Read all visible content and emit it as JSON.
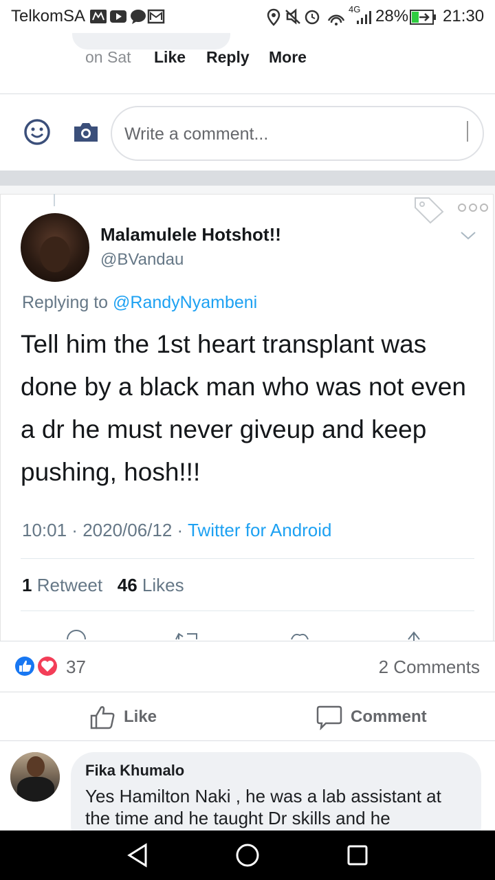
{
  "status_bar": {
    "carrier": "TelkomSA",
    "network": "4G",
    "battery": "28%",
    "time": "21:30"
  },
  "previous_comment": {
    "time": "on Sat",
    "like_label": "Like",
    "reply_label": "Reply",
    "more_label": "More"
  },
  "composer": {
    "placeholder": "Write a comment..."
  },
  "tweet": {
    "display_name": "Malamulele Hotshot!!",
    "handle": "@BVandau",
    "replying_prefix": "Replying to",
    "replying_to": "@RandyNyambeni",
    "body": "Tell him the 1st heart transplant was done by a black man who was not even a dr he must never giveup and keep pushing, hosh!!!",
    "time": "10:01",
    "date": "2020/06/12",
    "source": "Twitter for Android",
    "retweet_count": "1",
    "retweet_label": "Retweet",
    "likes_count": "46",
    "likes_label": "Likes"
  },
  "post_stats": {
    "reaction_count": "37",
    "comments": "2 Comments"
  },
  "actions": {
    "like_label": "Like",
    "comment_label": "Comment"
  },
  "comment": {
    "author": "Fika Khumalo",
    "text": "Yes Hamilton Naki , he was a lab assistant at the time and he taught Dr skills and he"
  },
  "colors": {
    "facebook_blue": "#1877f2",
    "twitter_blue": "#1da1f2",
    "love_red": "#f33e58"
  }
}
